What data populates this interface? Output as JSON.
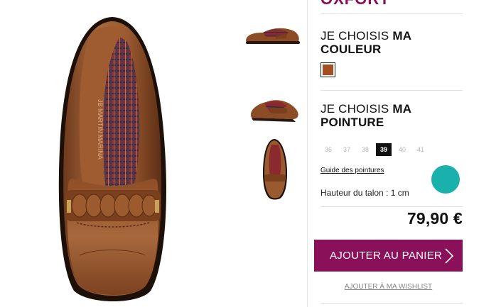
{
  "product": {
    "brand_partial": "OXFORT",
    "main_image_alt": "Mocassin cuir marron vue de dessus",
    "insole_text": "JB MARTIN MARINA",
    "thumbnails": [
      {
        "name": "thumb-side"
      },
      {
        "name": "thumb-angle"
      },
      {
        "name": "thumb-top"
      }
    ]
  },
  "color_section": {
    "title_regular": "JE CHOISIS ",
    "title_bold_1": "MA",
    "title_bold_2": "COULEUR",
    "selected_color": "#a24f22"
  },
  "size_section": {
    "title_regular": "JE CHOISIS ",
    "title_bold_1": "MA",
    "title_bold_2": "POINTURE",
    "sizes": [
      "36",
      "37",
      "38",
      "39",
      "40",
      "41"
    ],
    "selected": "39",
    "guide_label": "Guide des pointures",
    "heel_label": "Hauteur du talon : 1 cm"
  },
  "price": "79,90 €",
  "actions": {
    "add_to_cart": "AJOUTER AU PANIER",
    "wishlist": "AJOUTER À MA WISHLIST"
  },
  "colors": {
    "accent": "#8a1059",
    "chat": "#1ab0ac"
  }
}
